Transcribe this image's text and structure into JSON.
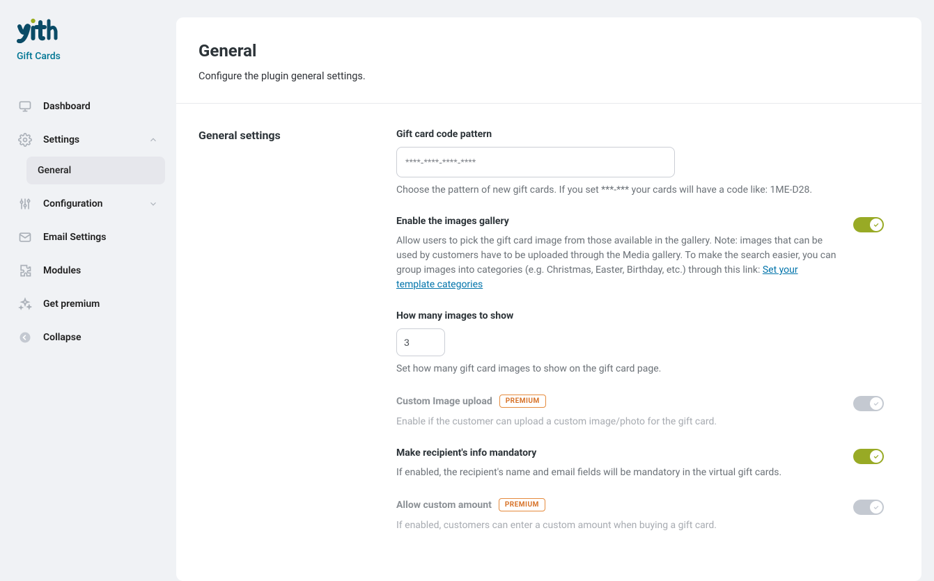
{
  "brand": {
    "subtitle": "Gift Cards"
  },
  "nav": {
    "dashboard": "Dashboard",
    "settings": "Settings",
    "settings_general": "General",
    "configuration": "Configuration",
    "email": "Email Settings",
    "modules": "Modules",
    "premium": "Get premium",
    "collapse": "Collapse"
  },
  "page": {
    "title": "General",
    "subtitle": "Configure the plugin general settings."
  },
  "section_title": "General settings",
  "fields": {
    "pattern": {
      "label": "Gift card code pattern",
      "value": "****-****-****-****",
      "help": "Choose the pattern of new gift cards. If you set ***-*** your cards will have a code like: 1ME-D28."
    },
    "gallery": {
      "label": "Enable the images gallery",
      "help": "Allow users to pick the gift card image from those available in the gallery. Note: images that can be used by customers have to be uploaded through the Media gallery. To make the search easier, you can group images into categories (e.g. Christmas, Easter, Birthday, etc.) through this link: ",
      "link_text": "Set your template categories"
    },
    "count": {
      "label": "How many images to show",
      "value": "3",
      "help": "Set how many gift card images to show on the gift card page."
    },
    "custom_image": {
      "label": "Custom Image upload",
      "badge": "PREMIUM",
      "help": "Enable if the customer can upload a custom image/photo for the gift card."
    },
    "mandatory": {
      "label": "Make recipient's info mandatory",
      "help": "If enabled, the recipient's name and email fields will be mandatory in the virtual gift cards."
    },
    "custom_amount": {
      "label": "Allow custom amount",
      "badge": "PREMIUM",
      "help": "If enabled, customers can enter a custom amount when buying a gift card."
    }
  }
}
